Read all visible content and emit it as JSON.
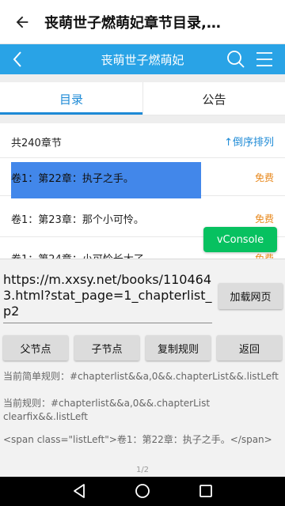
{
  "appbar": {
    "title": "丧萌世子燃萌妃章节目录,…"
  },
  "site": {
    "title": "丧萌世子燃萌妃"
  },
  "tabs": [
    "目录",
    "公告"
  ],
  "list": {
    "count": "共240章节",
    "sort": "↑倒序排列",
    "chapters": [
      {
        "title": "卷1：第22章：执子之手。",
        "badge": "免费"
      },
      {
        "title": "卷1：第23章：那个小可怜。",
        "badge": "免费"
      },
      {
        "title": "卷1：第24章：小可怜长大了。",
        "badge": "免费"
      }
    ]
  },
  "vconsole": "vConsole",
  "panel": {
    "url": "https://m.xxsy.net/books/1104643.html?stat_page=1_chapterlist_p2",
    "load_button": "加载网页",
    "buttons": [
      "父节点",
      "子节点",
      "复制规则",
      "返回"
    ],
    "simple_rule": "当前简单规则：#chapterlist&&a,0&&.chapterList&&.listLeft",
    "rule": "当前规则：#chapterlist&&a,0&&.chapterList clearfix&&.listLeft",
    "html": "<span class=\"listLeft\">卷1：第22章：执子之手。</span>",
    "page_indicator": "1/2"
  },
  "colors": {
    "site_header": "#29a3e6",
    "tab_active": "#1d8ad6",
    "highlight": "#4287ea",
    "free_badge": "#e8891e",
    "vconsole": "#07c160"
  }
}
